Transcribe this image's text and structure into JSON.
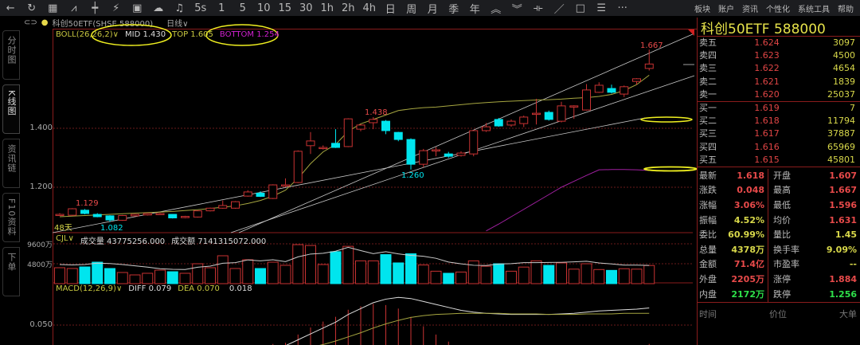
{
  "toolbar": {
    "icons": [
      "back-icon",
      "refresh-icon",
      "calculator-icon",
      "line-chart-icon",
      "candle-icon",
      "split-icon",
      "report-icon",
      "cloud-icon",
      "bell-icon"
    ],
    "periods": [
      "5s",
      "1",
      "5",
      "10",
      "15",
      "30",
      "1h",
      "2h",
      "4h",
      "日",
      "周",
      "月",
      "季",
      "年"
    ],
    "glyphs": [
      "←",
      "↻",
      "▦",
      "⩘",
      "┿",
      "⚡",
      "▣",
      "☁",
      "♫"
    ],
    "tools": [
      "︽",
      "︾",
      "⟛",
      "／",
      "□",
      "☰",
      "···"
    ],
    "menus": [
      "板块",
      "账户",
      "资讯",
      "个性化",
      "系统工具",
      "帮助"
    ]
  },
  "title": {
    "name": "科创50ETF(SHSE 588000)",
    "period": "日线∨"
  },
  "tabs": [
    "分时图",
    "K线图",
    "资讯链",
    "F10资料",
    "下单"
  ],
  "axis": {
    "price": [
      "1.400",
      "1.200"
    ],
    "volume": [
      "9600万",
      "4800万"
    ],
    "macd": [
      "0.050"
    ]
  },
  "boll": {
    "label": "BOLL(26,26,2)∨",
    "mid": "MID 1.430",
    "top": "TOP 1.605",
    "bottom": "BOTTOM 1.254"
  },
  "cjl": {
    "label": "CJL∨",
    "vol": "成交量 43775256.000",
    "amt": "成交额 7141315072.000"
  },
  "macd": {
    "label": "MACD(12,26,9)∨",
    "diff": "DIFF 0.079",
    "dea": "DEA 0.070",
    "hist": "0.018"
  },
  "annotations": {
    "high1": "1.129",
    "low1": "1.082",
    "high2": "1.438",
    "low2": "1.260",
    "high3": "1.667",
    "days": "48天"
  },
  "colors": {
    "up": "#c83232",
    "down": "#00e5ee",
    "ma": "#a6a640",
    "purple": "#a020a0",
    "highlight": "#f0f020"
  },
  "chart_data": {
    "type": "candlestick",
    "ohlc": [
      [
        1.108,
        1.112,
        1.104,
        1.108
      ],
      [
        1.105,
        1.129,
        1.103,
        1.127
      ],
      [
        1.122,
        1.126,
        1.108,
        1.111
      ],
      [
        1.108,
        1.112,
        1.098,
        1.1
      ],
      [
        1.103,
        1.105,
        1.082,
        1.089
      ],
      [
        1.088,
        1.106,
        1.086,
        1.104
      ],
      [
        1.103,
        1.109,
        1.101,
        1.108
      ],
      [
        1.106,
        1.113,
        1.104,
        1.111
      ],
      [
        1.111,
        1.114,
        1.108,
        1.111
      ],
      [
        1.108,
        1.109,
        1.094,
        1.096
      ],
      [
        1.097,
        1.103,
        1.095,
        1.101
      ],
      [
        1.099,
        1.122,
        1.097,
        1.12
      ],
      [
        1.12,
        1.131,
        1.118,
        1.129
      ],
      [
        1.129,
        1.155,
        1.127,
        1.138
      ],
      [
        1.129,
        1.153,
        1.127,
        1.151
      ],
      [
        1.17,
        1.19,
        1.168,
        1.184
      ],
      [
        1.18,
        1.186,
        1.167,
        1.169
      ],
      [
        1.162,
        1.21,
        1.16,
        1.208
      ],
      [
        1.208,
        1.23,
        1.2,
        1.208
      ],
      [
        1.216,
        1.325,
        1.214,
        1.322
      ],
      [
        1.341,
        1.387,
        1.313,
        1.357
      ],
      [
        1.335,
        1.342,
        1.328,
        1.335
      ],
      [
        1.349,
        1.397,
        1.333,
        1.335
      ],
      [
        1.338,
        1.434,
        1.336,
        1.432
      ],
      [
        1.397,
        1.414,
        1.39,
        1.411
      ],
      [
        1.419,
        1.438,
        1.397,
        1.43
      ],
      [
        1.424,
        1.428,
        1.38,
        1.392
      ],
      [
        1.386,
        1.388,
        1.356,
        1.362
      ],
      [
        1.362,
        1.366,
        1.26,
        1.278
      ],
      [
        1.278,
        1.33,
        1.268,
        1.324
      ],
      [
        1.327,
        1.336,
        1.305,
        1.327
      ],
      [
        1.313,
        1.32,
        1.3,
        1.305
      ],
      [
        1.308,
        1.322,
        1.304,
        1.316
      ],
      [
        1.313,
        1.394,
        1.305,
        1.392
      ],
      [
        1.392,
        1.418,
        1.388,
        1.405
      ],
      [
        1.43,
        1.435,
        1.405,
        1.408
      ],
      [
        1.411,
        1.43,
        1.405,
        1.424
      ],
      [
        1.416,
        1.443,
        1.404,
        1.438
      ],
      [
        1.451,
        1.5,
        1.413,
        1.451
      ],
      [
        1.454,
        1.46,
        1.426,
        1.43
      ],
      [
        1.424,
        1.49,
        1.42,
        1.476
      ],
      [
        1.476,
        1.478,
        1.432,
        1.476
      ],
      [
        1.462,
        1.55,
        1.46,
        1.53
      ],
      [
        1.522,
        1.556,
        1.52,
        1.546
      ],
      [
        1.535,
        1.548,
        1.518,
        1.522
      ],
      [
        1.516,
        1.545,
        1.506,
        1.541
      ],
      [
        1.559,
        1.57,
        1.548,
        1.568
      ],
      [
        1.603,
        1.667,
        1.596,
        1.618
      ]
    ],
    "ma": [
      1.1,
      1.102,
      1.104,
      1.106,
      1.108,
      1.11,
      1.112,
      1.114,
      1.116,
      1.118,
      1.121,
      1.124,
      1.128,
      1.132,
      1.137,
      1.145,
      1.155,
      1.17,
      1.19,
      1.23,
      1.28,
      1.32,
      1.345,
      1.39,
      1.415,
      1.43,
      1.445,
      1.46,
      1.466,
      1.47,
      1.472,
      1.476,
      1.48,
      1.484,
      1.487,
      1.49,
      1.492,
      1.494,
      1.496,
      1.497,
      1.499,
      1.502,
      1.504,
      1.508,
      1.515,
      1.528,
      1.548,
      1.58
    ],
    "bottom": [
      null,
      null,
      null,
      null,
      null,
      null,
      null,
      null,
      null,
      null,
      null,
      null,
      null,
      null,
      null,
      null,
      null,
      null,
      null,
      null,
      null,
      null,
      null,
      null,
      null,
      null,
      null,
      null,
      null,
      null,
      null,
      null,
      null,
      null,
      1.052,
      1.075,
      1.1,
      1.125,
      1.15,
      1.175,
      1.2,
      1.22,
      1.24,
      1.259,
      1.26,
      1.26,
      1.259,
      1.257
    ],
    "volume": [
      3840,
      3650,
      4030,
      5180,
      3650,
      2690,
      2110,
      2500,
      3260,
      2880,
      2500,
      4800,
      3840,
      6720,
      3650,
      5760,
      3650,
      5180,
      4420,
      9400,
      9200,
      4600,
      7700,
      9000,
      5500,
      5500,
      7000,
      5000,
      7200,
      4500,
      3000,
      2500,
      2800,
      5500,
      4200,
      4800,
      3000,
      4000,
      5500,
      4400,
      5000,
      3500,
      4800,
      3400,
      3200,
      3600,
      3500,
      4378
    ],
    "diff": [
      0,
      0.001,
      0.002,
      0.002,
      0.003,
      0.003,
      0.004,
      0.004,
      0.005,
      0.005,
      0.006,
      0.006,
      0.007,
      0.008,
      0.009,
      0.01,
      0.011,
      0.013,
      0.015,
      0.025,
      0.035,
      0.045,
      0.055,
      0.068,
      0.078,
      0.088,
      0.094,
      0.097,
      0.095,
      0.09,
      0.085,
      0.08,
      0.075,
      0.072,
      0.07,
      0.069,
      0.068,
      0.068,
      0.068,
      0.068,
      0.069,
      0.07,
      0.072,
      0.074,
      0.075,
      0.076,
      0.077,
      0.079
    ],
    "dea": [
      0,
      0,
      0,
      0,
      0,
      0,
      0,
      0,
      0.001,
      0.001,
      0.001,
      0.002,
      0.002,
      0.002,
      0.003,
      0.003,
      0.004,
      0.004,
      0.005,
      0.008,
      0.012,
      0.017,
      0.023,
      0.03,
      0.037,
      0.045,
      0.052,
      0.058,
      0.063,
      0.066,
      0.068,
      0.069,
      0.07,
      0.07,
      0.07,
      0.07,
      0.069,
      0.069,
      0.069,
      0.068,
      0.068,
      0.068,
      0.069,
      0.069,
      0.069,
      0.07,
      0.07,
      0.07
    ]
  },
  "panel": {
    "title": "科创50ETF  588000",
    "asks": [
      {
        "n": "卖五",
        "p": "1.624",
        "v": "3097"
      },
      {
        "n": "卖四",
        "p": "1.623",
        "v": "4500"
      },
      {
        "n": "卖三",
        "p": "1.622",
        "v": "4654"
      },
      {
        "n": "卖二",
        "p": "1.621",
        "v": "1839"
      },
      {
        "n": "卖一",
        "p": "1.620",
        "v": "25037"
      }
    ],
    "bids": [
      {
        "n": "买一",
        "p": "1.619",
        "v": "7"
      },
      {
        "n": "买二",
        "p": "1.618",
        "v": "11794"
      },
      {
        "n": "买三",
        "p": "1.617",
        "v": "37887"
      },
      {
        "n": "买四",
        "p": "1.616",
        "v": "65969"
      },
      {
        "n": "买五",
        "p": "1.615",
        "v": "45801"
      }
    ],
    "stats": [
      {
        "k": "最新",
        "v": "1.618",
        "c": "r",
        "k2": "开盘",
        "v2": "1.607",
        "c2": "r"
      },
      {
        "k": "涨跌",
        "v": "0.048",
        "c": "r",
        "k2": "最高",
        "v2": "1.667",
        "c2": "r"
      },
      {
        "k": "涨幅",
        "v": "3.06%",
        "c": "r",
        "k2": "最低",
        "v2": "1.596",
        "c2": "r"
      },
      {
        "k": "振幅",
        "v": "4.52%",
        "c": "y",
        "k2": "均价",
        "v2": "1.631",
        "c2": "r"
      },
      {
        "k": "委比",
        "v": "60.99%",
        "c": "y",
        "k2": "量比",
        "v2": "1.45",
        "c2": "y"
      },
      {
        "k": "总量",
        "v": "4378万",
        "c": "y",
        "k2": "换手率",
        "v2": "9.09%",
        "c2": "y"
      },
      {
        "k": "金额",
        "v": "71.4亿",
        "c": "r",
        "k2": "市盈率",
        "v2": "--",
        "c2": "y"
      },
      {
        "k": "外盘",
        "v": "2205万",
        "c": "r",
        "k2": "涨停",
        "v2": "1.884",
        "c2": "r"
      },
      {
        "k": "内盘",
        "v": "2172万",
        "c": "g",
        "k2": "跌停",
        "v2": "1.256",
        "c2": "g"
      }
    ],
    "footer": [
      "时间",
      "价位",
      "大单"
    ]
  }
}
